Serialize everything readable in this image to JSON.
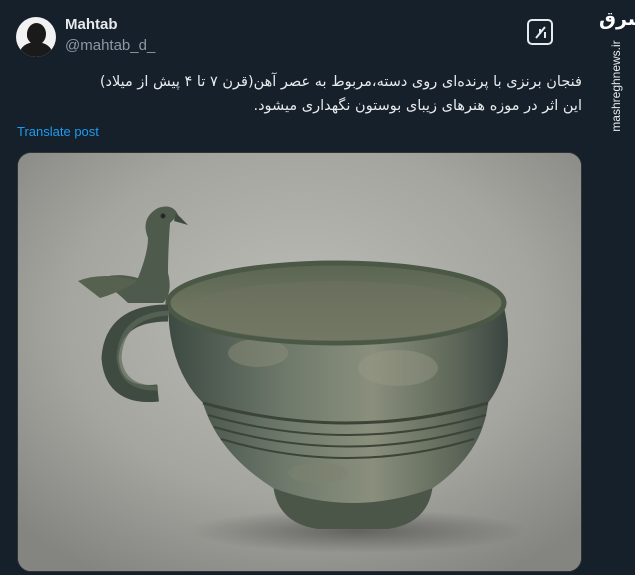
{
  "post": {
    "author_name": "Mahtab",
    "author_handle": "@mahtab_d_",
    "text_lines": [
      "فنجان برنزی با پرنده‌ای روی دسته،مربوط به عصر آهن(قرن ۷ تا ۴ پیش از میلاد)",
      "این اثر در موزه هنرهای زیبای بوستون نگهداری میشود."
    ],
    "translate_label": "Translate post",
    "grok_icon": "grok-icon",
    "media_icon": "bronze-cup-with-bird-handle"
  },
  "watermark": {
    "logo": "مشرق",
    "site": "mashreghnews.ir"
  },
  "colors": {
    "background": "#15202b",
    "link": "#1d9bf0",
    "text": "#e7e9ea",
    "muted": "#8b98a5"
  }
}
